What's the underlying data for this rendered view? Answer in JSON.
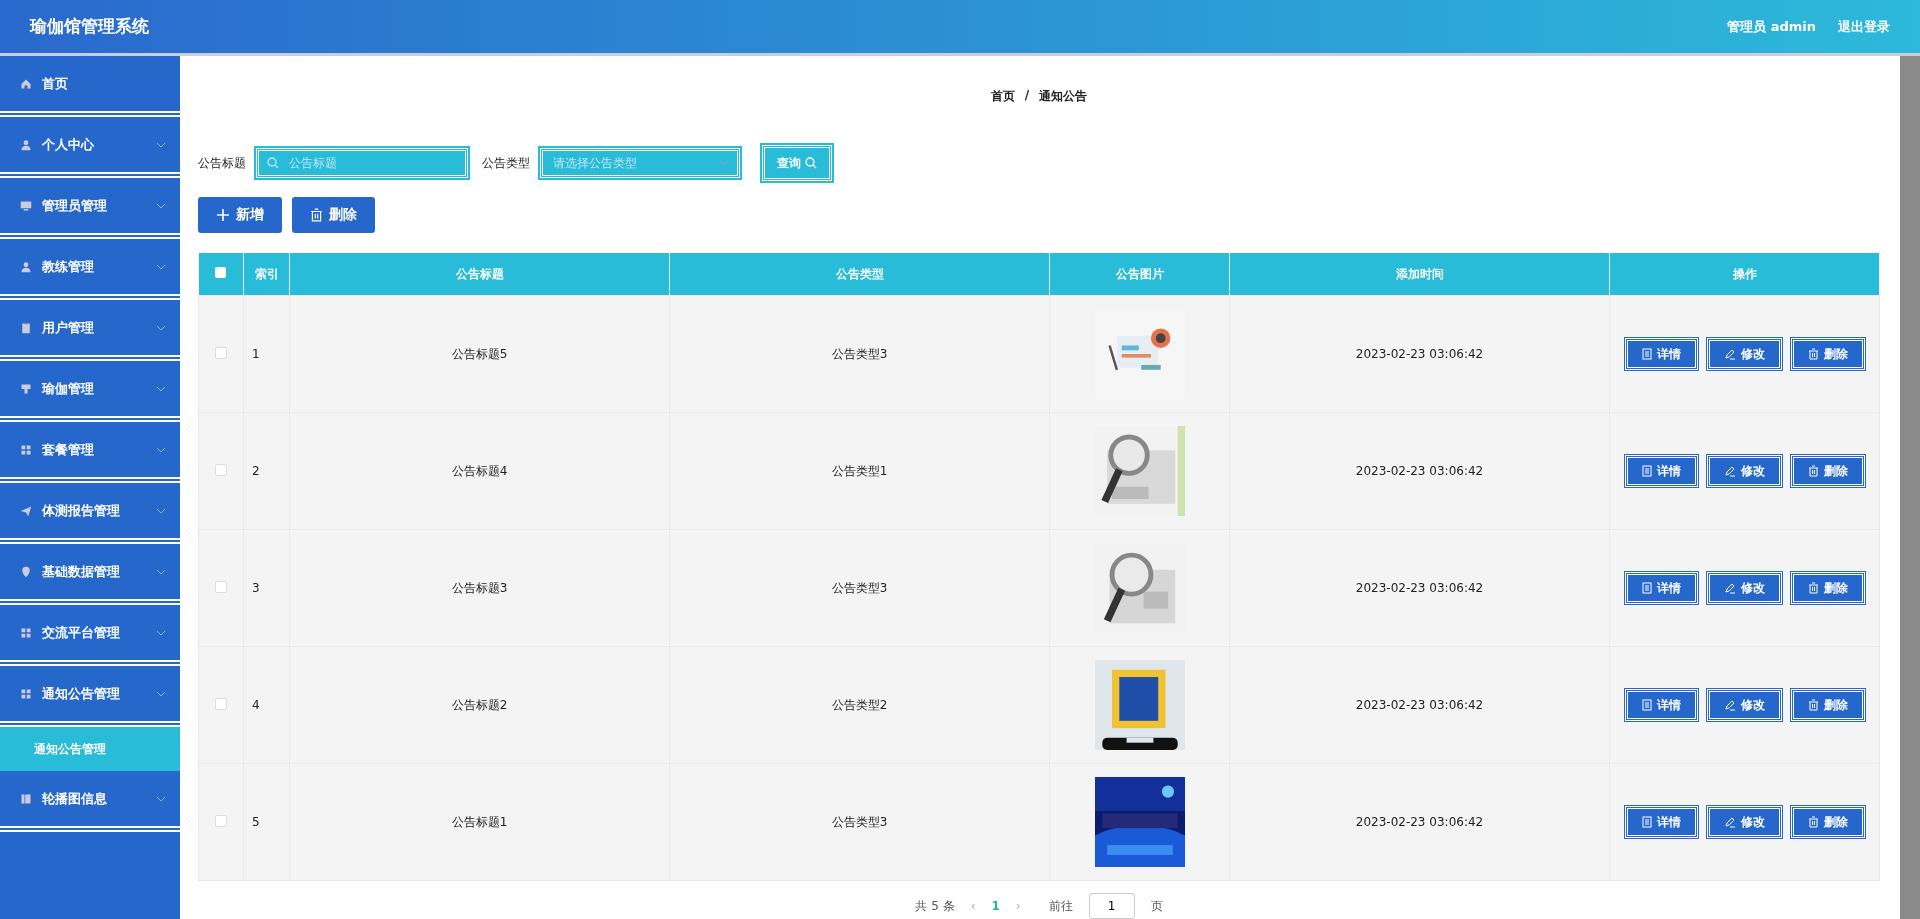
{
  "header": {
    "title": "瑜伽馆管理系统",
    "user": "管理员 admin",
    "logout": "退出登录"
  },
  "sidebar": {
    "items": [
      {
        "label": "首页",
        "kind": "link"
      },
      {
        "label": "个人中心",
        "kind": "menu"
      },
      {
        "label": "管理员管理",
        "kind": "menu"
      },
      {
        "label": "教练管理",
        "kind": "menu"
      },
      {
        "label": "用户管理",
        "kind": "menu"
      },
      {
        "label": "瑜伽管理",
        "kind": "menu"
      },
      {
        "label": "套餐管理",
        "kind": "menu"
      },
      {
        "label": "体测报告管理",
        "kind": "menu"
      },
      {
        "label": "基础数据管理",
        "kind": "menu"
      },
      {
        "label": "交流平台管理",
        "kind": "menu"
      },
      {
        "label": "通知公告管理",
        "kind": "menu",
        "children": [
          {
            "label": "通知公告管理",
            "selected": true
          }
        ]
      },
      {
        "label": "轮播图信息",
        "kind": "menu"
      }
    ]
  },
  "breadcrumb": [
    "首页",
    "/",
    "通知公告"
  ],
  "search": {
    "title_label": "公告标题",
    "title_placeholder": "公告标题",
    "type_label": "公告类型",
    "type_placeholder": "请选择公告类型",
    "query_button": "查询"
  },
  "actions": [
    "新增",
    "删除"
  ],
  "table": {
    "columns": [
      "索引",
      "公告标题",
      "公告类型",
      "公告图片",
      "添加时间",
      "操作"
    ],
    "rows": [
      {
        "index": "1",
        "title": "公告标题5",
        "type": "公告类型3",
        "time": "2023-02-23 03:06:42",
        "checked": false,
        "buttons": [
          "详情",
          "修改",
          "删除"
        ]
      },
      {
        "index": "2",
        "title": "公告标题4",
        "type": "公告类型1",
        "time": "2023-02-23 03:06:42",
        "checked": false,
        "buttons": [
          "详情",
          "修改",
          "删除"
        ]
      },
      {
        "index": "3",
        "title": "公告标题3",
        "type": "公告类型3",
        "time": "2023-02-23 03:06:42",
        "checked": false,
        "buttons": [
          "详情",
          "修改",
          "删除"
        ]
      },
      {
        "index": "4",
        "title": "公告标题2",
        "type": "公告类型2",
        "time": "2023-02-23 03:06:42",
        "checked": false,
        "buttons": [
          "详情",
          "修改",
          "删除"
        ]
      },
      {
        "index": "5",
        "title": "公告标题1",
        "type": "公告类型3",
        "time": "2023-02-23 03:06:42",
        "checked": false,
        "buttons": [
          "详情",
          "修改",
          "删除"
        ]
      }
    ],
    "select_all_checked": false
  },
  "pagination": {
    "total": "共 5 条",
    "prev": "‹",
    "next": "›",
    "pages": [
      {
        "label": "1",
        "selected": true
      }
    ],
    "goto_label": "前往",
    "goto_value": "1",
    "page_suffix": "页"
  }
}
